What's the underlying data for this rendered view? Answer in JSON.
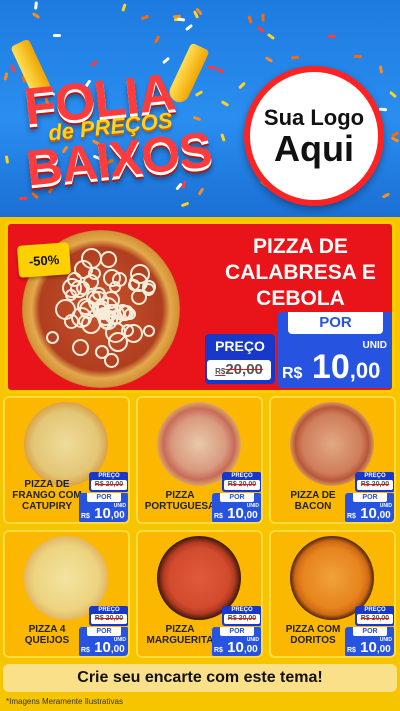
{
  "header": {
    "title_line1": "FOLIA",
    "title_line2": "de PREÇOS",
    "title_line3": "BAIXOS",
    "logo_line1": "Sua Logo",
    "logo_line2": "Aqui"
  },
  "featured": {
    "discount": "-50%",
    "name": "PIZZA DE CALABRESA E CEBOLA",
    "preco_label": "PREÇO",
    "old_price_prefix": "R$",
    "old_price": "20,00",
    "por_label": "POR",
    "unid": "UNID",
    "new_price_prefix": "R$",
    "new_price_int": "10",
    "new_price_cents": ",00"
  },
  "products": [
    {
      "name": "PIZZA DE FRANGO COM CATUPIRY",
      "preco_label": "PREÇO",
      "old_price": "R$ 20,00",
      "por_label": "POR",
      "unid": "UNID",
      "price_prefix": "R$",
      "price_int": "10",
      "price_cents": ",00",
      "style": "frango"
    },
    {
      "name": "PIZZA PORTUGUESA",
      "preco_label": "PREÇO",
      "old_price": "R$ 20,00",
      "por_label": "POR",
      "unid": "UNID",
      "price_prefix": "R$",
      "price_int": "10",
      "price_cents": ",00",
      "style": "portuguesa"
    },
    {
      "name": "PIZZA DE BACON",
      "preco_label": "PREÇO",
      "old_price": "R$ 20,00",
      "por_label": "POR",
      "unid": "UNID",
      "price_prefix": "R$",
      "price_int": "10",
      "price_cents": ",00",
      "style": "bacon"
    },
    {
      "name": "PIZZA 4 QUEIJOS",
      "preco_label": "PREÇO",
      "old_price": "R$ 20,00",
      "por_label": "POR",
      "unid": "UNID",
      "price_prefix": "R$",
      "price_int": "10",
      "price_cents": ",00",
      "style": "queijos"
    },
    {
      "name": "PIZZA MARGUERITA",
      "preco_label": "PREÇO",
      "old_price": "R$ 20,00",
      "por_label": "POR",
      "unid": "UNID",
      "price_prefix": "R$",
      "price_int": "10",
      "price_cents": ",00",
      "style": "marguerita"
    },
    {
      "name": "PIZZA COM DORITOS",
      "preco_label": "PREÇO",
      "old_price": "R$ 20,00",
      "por_label": "POR",
      "unid": "UNID",
      "price_prefix": "R$",
      "price_int": "10",
      "price_cents": ",00",
      "style": "doritos"
    }
  ],
  "cta": "Crie seu encarte com este tema!",
  "disclaimer": "*Imagens Meramente Ilustrativas",
  "colors": {
    "header_blue": "#1e7be0",
    "featured_red": "#e8141a",
    "card_yellow": "#fcb800",
    "price_blue": "#2654e0",
    "logo_border": "#ff2222"
  }
}
